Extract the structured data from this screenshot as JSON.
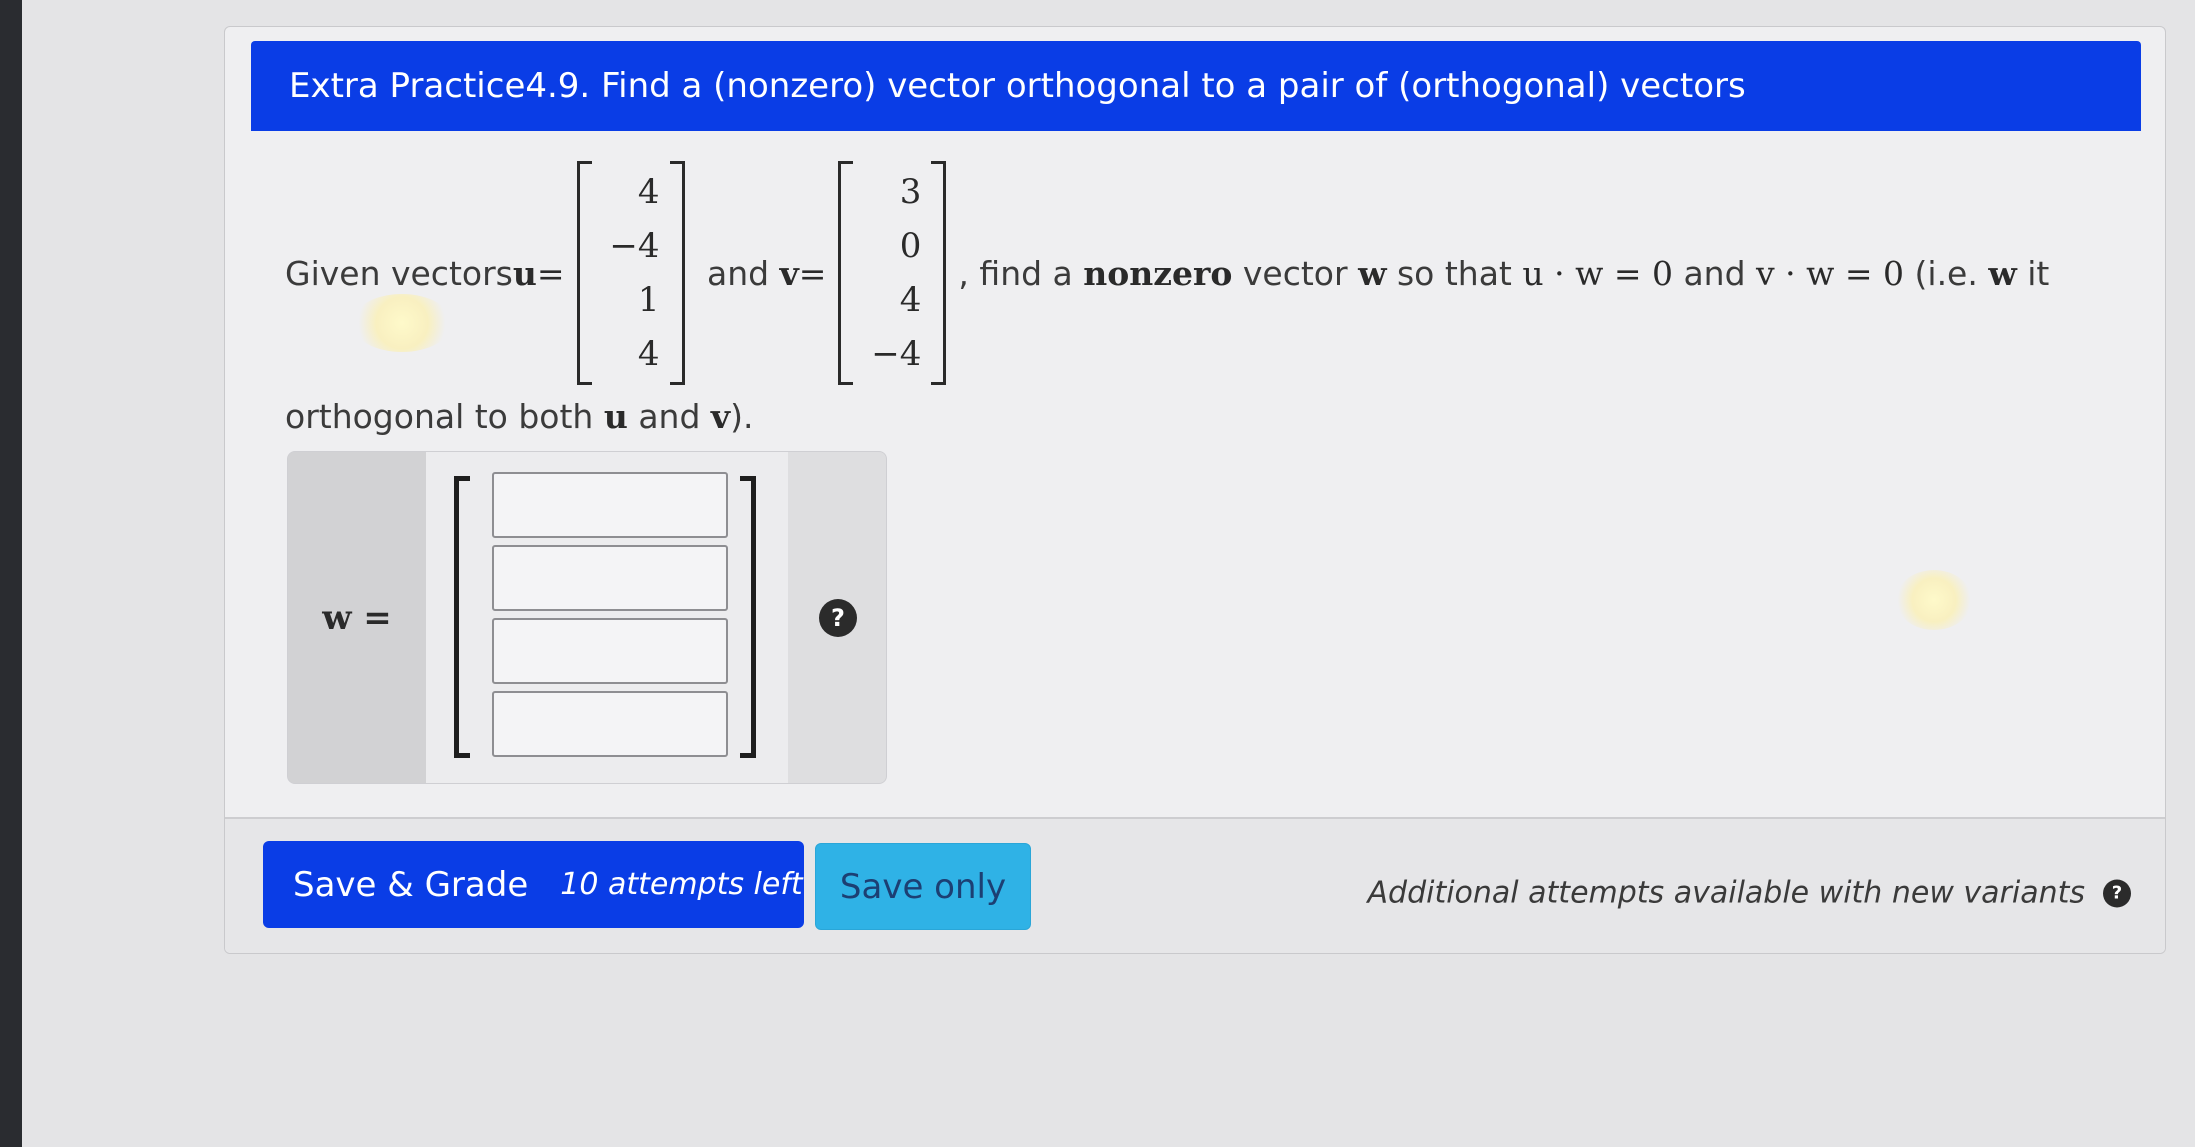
{
  "header": {
    "title": "Extra Practice4.9. Find a (nonzero) vector orthogonal to a pair of (orthogonal) vectors"
  },
  "problem": {
    "prefix": "Given vectors ",
    "u_symbol": "u",
    "equals": " = ",
    "u_vector": [
      "4",
      "−4",
      "1",
      "4"
    ],
    "and_text": " and ",
    "v_symbol": "v",
    "v_vector": [
      "3",
      "0",
      "4",
      "−4"
    ],
    "find_text": ", find a ",
    "nonzero": "nonzero",
    "vector_text": " vector ",
    "w_symbol": "w",
    "so_that": " so that ",
    "eq1": "u · w = 0",
    "and2": " and ",
    "eq2": "v · w = 0",
    "ie_text": " (i.e. ",
    "it_text": " it",
    "line2_prefix": "orthogonal to both ",
    "line2_and": " and ",
    "line2_suffix": ")."
  },
  "answer": {
    "label": "w =",
    "entries": [
      "",
      "",
      "",
      ""
    ],
    "help_icon": "?"
  },
  "footer": {
    "save_grade_label": "Save & Grade",
    "attempts_label": "10 attempts left",
    "save_only_label": "Save only",
    "note": "Additional attempts available with new variants",
    "note_help": "?"
  },
  "colors": {
    "header_blue": "#0a3de6",
    "save_only_blue": "#2fb2e6"
  }
}
